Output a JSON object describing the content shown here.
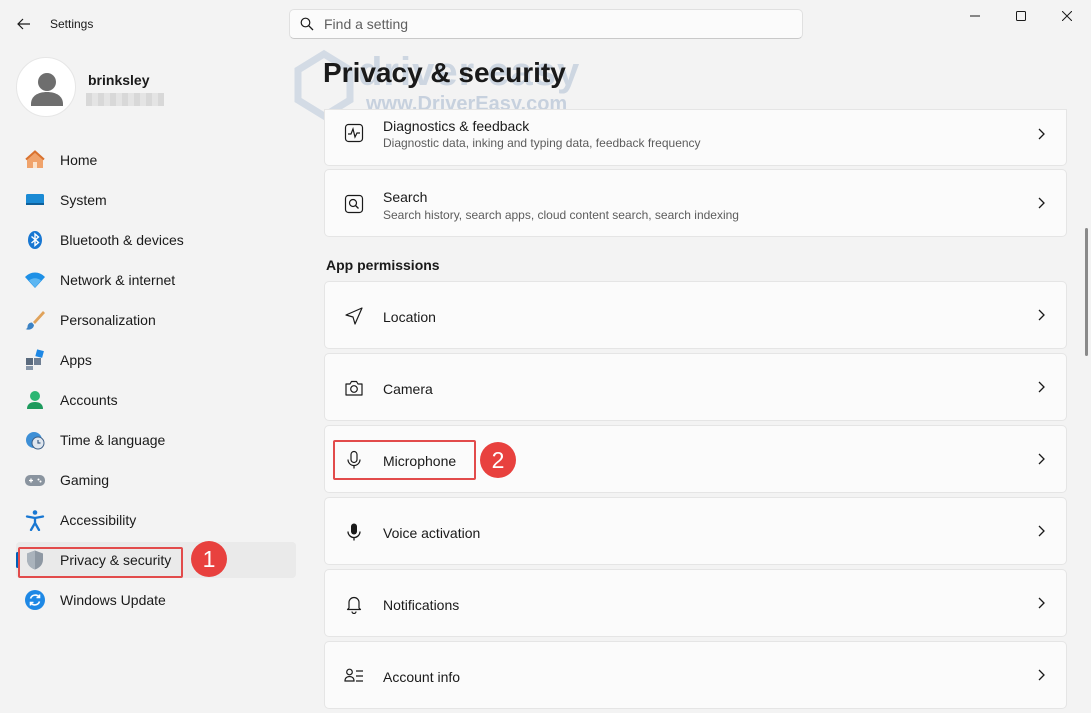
{
  "window": {
    "app_title": "Settings",
    "search_placeholder": "Find a setting"
  },
  "profile": {
    "name": "brinksley"
  },
  "sidebar": {
    "items": [
      {
        "label": "Home",
        "icon": "home-icon"
      },
      {
        "label": "System",
        "icon": "system-icon"
      },
      {
        "label": "Bluetooth & devices",
        "icon": "bluetooth-icon"
      },
      {
        "label": "Network & internet",
        "icon": "wifi-icon"
      },
      {
        "label": "Personalization",
        "icon": "brush-icon"
      },
      {
        "label": "Apps",
        "icon": "apps-icon"
      },
      {
        "label": "Accounts",
        "icon": "accounts-icon"
      },
      {
        "label": "Time & language",
        "icon": "time-language-icon"
      },
      {
        "label": "Gaming",
        "icon": "gamepad-icon"
      },
      {
        "label": "Accessibility",
        "icon": "accessibility-icon"
      },
      {
        "label": "Privacy & security",
        "icon": "shield-icon",
        "active": true
      },
      {
        "label": "Windows Update",
        "icon": "update-icon"
      }
    ]
  },
  "main": {
    "title": "Privacy & security",
    "watermark": {
      "brand": "driver easy",
      "url": "www.DriverEasy.com"
    },
    "top_cards": [
      {
        "title": "Diagnostics & feedback",
        "desc": "Diagnostic data, inking and typing data, feedback frequency",
        "icon": "diagnostics-icon"
      },
      {
        "title": "Search",
        "desc": "Search history, search apps, cloud content search, search indexing",
        "icon": "search-permission-icon"
      }
    ],
    "section_label": "App permissions",
    "permission_cards": [
      {
        "title": "Location",
        "icon": "location-icon"
      },
      {
        "title": "Camera",
        "icon": "camera-icon"
      },
      {
        "title": "Microphone",
        "icon": "microphone-icon"
      },
      {
        "title": "Voice activation",
        "icon": "voice-activation-icon"
      },
      {
        "title": "Notifications",
        "icon": "bell-icon"
      },
      {
        "title": "Account info",
        "icon": "account-info-icon"
      }
    ]
  },
  "annotations": {
    "step1": "1",
    "step2": "2",
    "color": "#e8413e"
  },
  "colors": {
    "accent": "#005fb8",
    "background": "#f3f3f3",
    "card": "#fbfbfb"
  }
}
